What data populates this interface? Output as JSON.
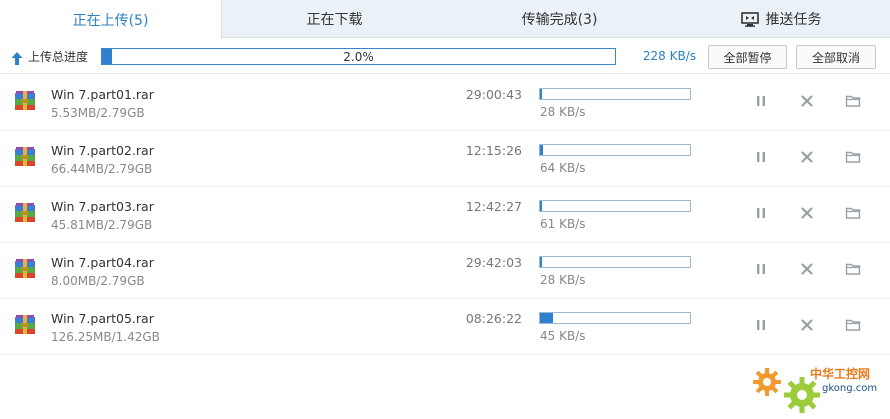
{
  "tabs": [
    {
      "label": "正在上传(5)",
      "active": true
    },
    {
      "label": "正在下载",
      "active": false
    },
    {
      "label": "传输完成(3)",
      "active": false
    },
    {
      "label": "推送任务",
      "active": false,
      "icon": "monitor-icon"
    }
  ],
  "summary": {
    "label": "上传总进度",
    "progress_text": "2.0%",
    "progress": 0.02,
    "speed": "228 KB/s",
    "pause_all": "全部暂停",
    "cancel_all": "全部取消"
  },
  "colors": {
    "accent": "#2f80cf",
    "tab_bg": "#eaf2f8",
    "watermark_orange": "#e87a1b",
    "watermark_green": "#8cc63f"
  },
  "files": [
    {
      "name": "Win 7.part01.rar",
      "size": "5.53MB/2.79GB",
      "time_left": "29:00:43",
      "speed": "28 KB/s",
      "progress": 0.002
    },
    {
      "name": "Win 7.part02.rar",
      "size": "66.44MB/2.79GB",
      "time_left": "12:15:26",
      "speed": "64 KB/s",
      "progress": 0.023
    },
    {
      "name": "Win 7.part03.rar",
      "size": "45.81MB/2.79GB",
      "time_left": "12:42:27",
      "speed": "61 KB/s",
      "progress": 0.016
    },
    {
      "name": "Win 7.part04.rar",
      "size": "8.00MB/2.79GB",
      "time_left": "29:42:03",
      "speed": "28 KB/s",
      "progress": 0.003
    },
    {
      "name": "Win 7.part05.rar",
      "size": "126.25MB/1.42GB",
      "time_left": "08:26:22",
      "speed": "45 KB/s",
      "progress": 0.087
    }
  ],
  "icons": {
    "file": "winrar-file-icon",
    "pause": "pause-icon",
    "close": "close-icon",
    "folder": "folder-icon"
  },
  "watermark": {
    "text": "中华工控网",
    "sub": "gkong.com"
  }
}
